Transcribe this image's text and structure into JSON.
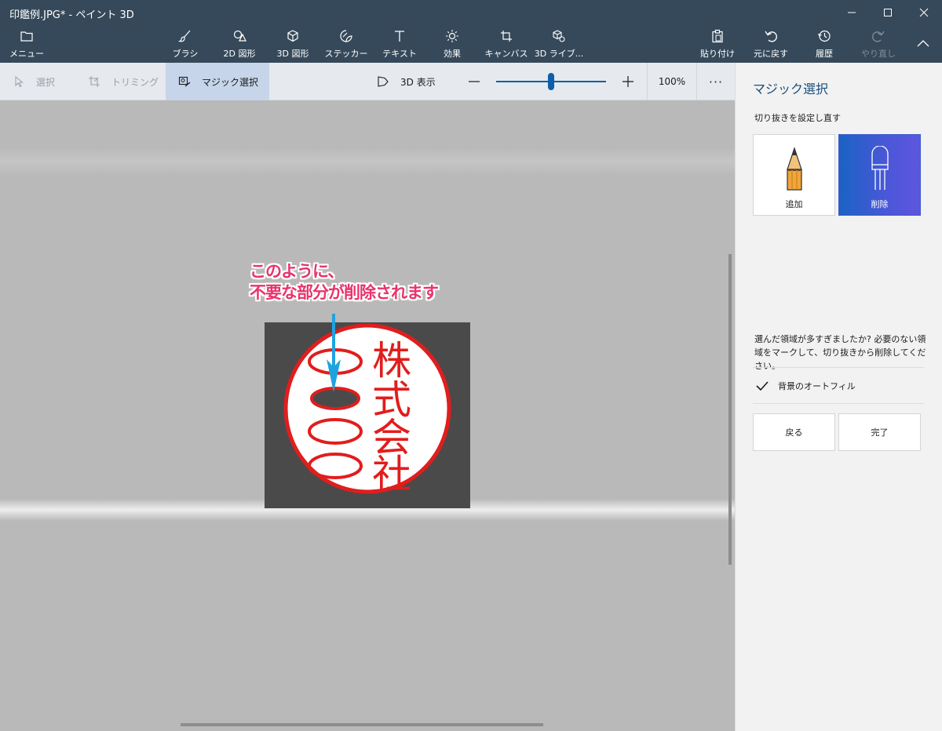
{
  "titlebar": {
    "title": "印鑑例.JPG* - ペイント 3D",
    "minimize_icon": "minimize-icon",
    "maximize_icon": "maximize-icon",
    "close_icon": "close-icon"
  },
  "ribbon": {
    "menu": "メニュー",
    "brush": "ブラシ",
    "shapes2d": "2D 図形",
    "shapes3d": "3D 図形",
    "stickers": "ステッカー",
    "text": "テキスト",
    "effects": "効果",
    "canvas": "キャンバス",
    "library3d": "3D ライブ...",
    "paste": "貼り付け",
    "undo": "元に戻す",
    "history": "履歴",
    "redo": "やり直し"
  },
  "toolbar": {
    "select": "選択",
    "crop": "トリミング",
    "magic_select": "マジック選択",
    "view3d": "3D 表示",
    "zoom_minus": "—",
    "zoom_plus": "+",
    "zoom_level": "100%",
    "zoom_slider_value": 0.5,
    "more": "···"
  },
  "canvas": {
    "annotation_line1": "このように、",
    "annotation_line2": "不要な部分が削除されます",
    "annotation_color": "#e8336c",
    "arrow_color": "#1fa3de",
    "stamp_text": [
      "株",
      "式",
      "会",
      "社"
    ],
    "stamp_color": "#e11d1d"
  },
  "panel": {
    "title": "マジック選択",
    "subtitle": "切り抜きを設定し直す",
    "add_label": "追加",
    "remove_label": "削除",
    "description": "選んだ領域が多すぎましたか? 必要のない領域をマークして、切り抜きから削除してください。",
    "autofill_label": "背景のオートフィル",
    "autofill_checked": true,
    "back_label": "戻る",
    "done_label": "完了",
    "accent": "#1a63c4"
  }
}
